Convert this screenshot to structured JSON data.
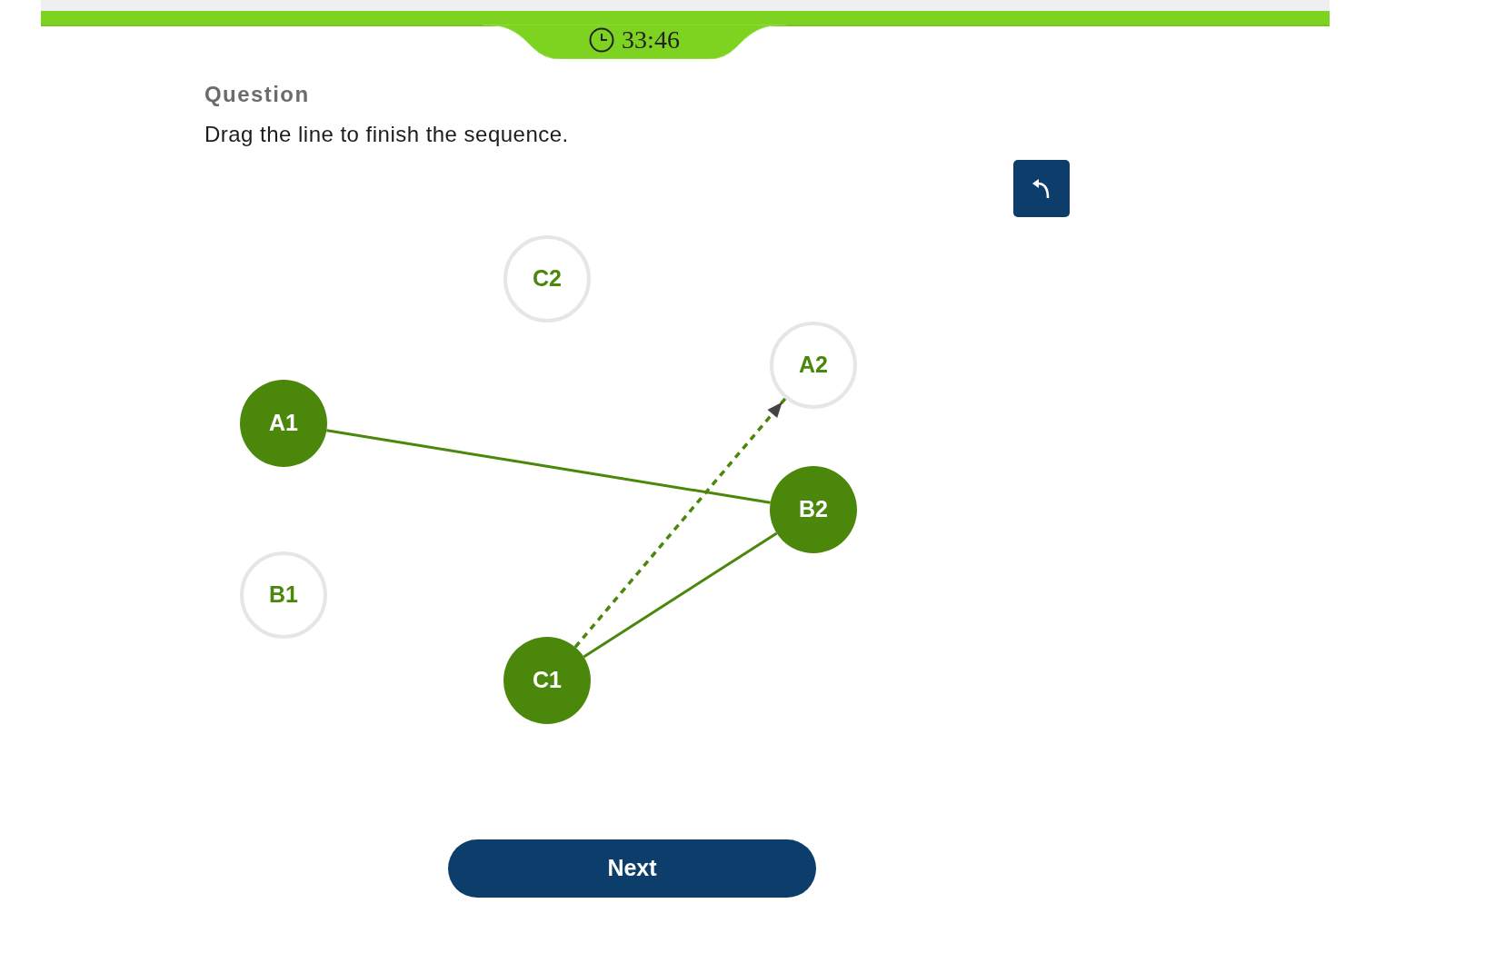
{
  "header": {
    "timer": "33:46"
  },
  "question": {
    "heading": "Question",
    "prompt": "Drag the line to finish the sequence."
  },
  "diagram": {
    "nodes": [
      {
        "label": "C2",
        "connected": false
      },
      {
        "label": "A2",
        "connected": false
      },
      {
        "label": "A1",
        "connected": true
      },
      {
        "label": "B2",
        "connected": true
      },
      {
        "label": "B1",
        "connected": false
      },
      {
        "label": "C1",
        "connected": true
      }
    ],
    "lines": [
      {
        "kind": "solid"
      },
      {
        "kind": "solid"
      },
      {
        "kind": "dashed"
      }
    ]
  },
  "next_button": {
    "label": "Next"
  }
}
